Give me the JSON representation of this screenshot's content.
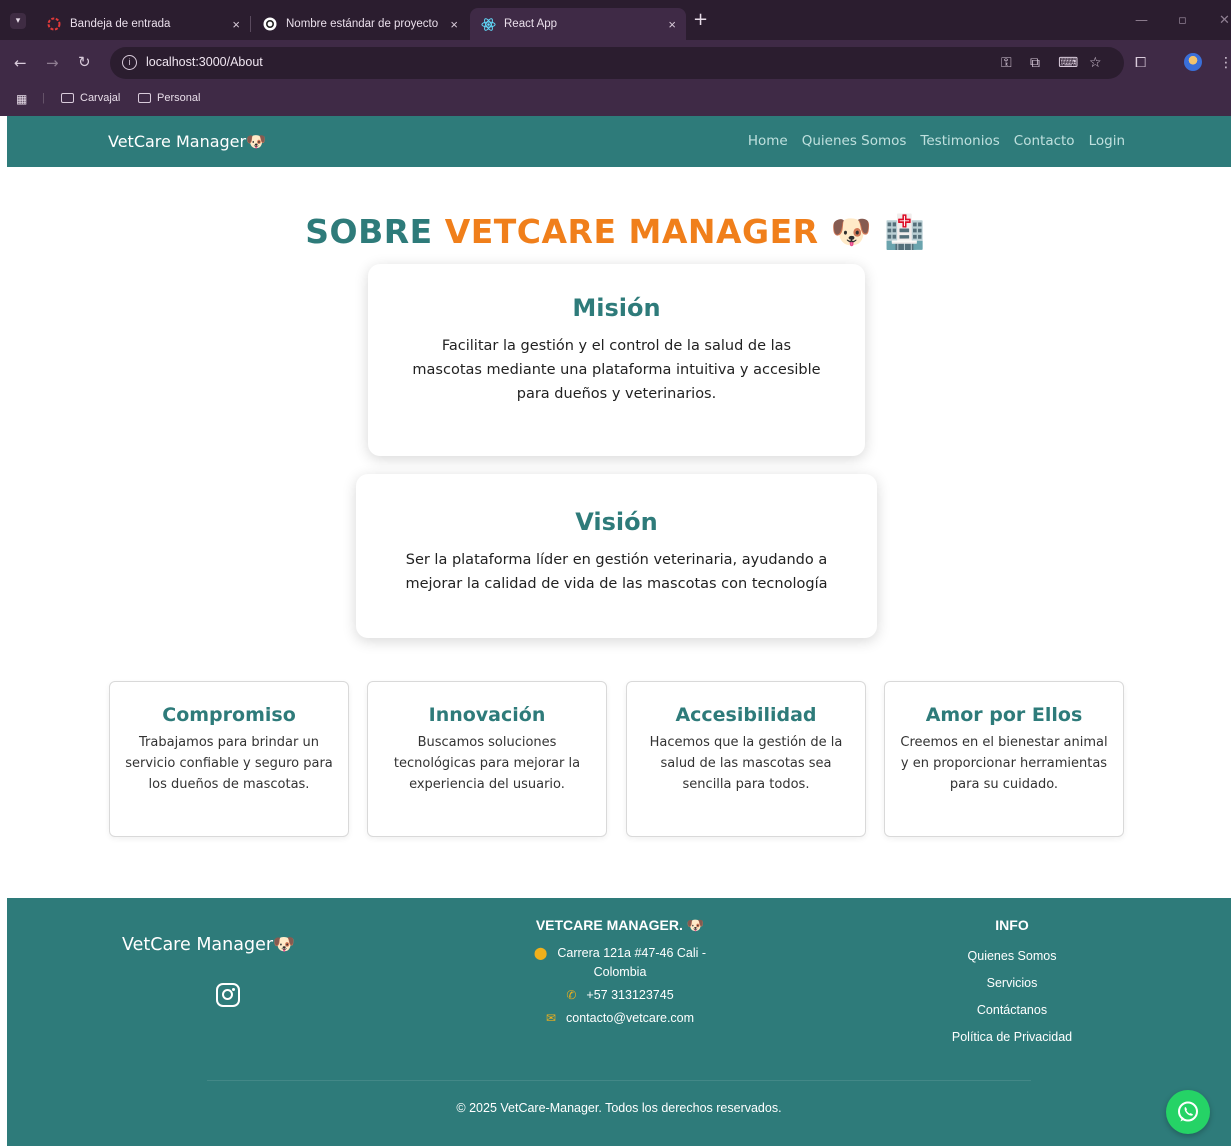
{
  "browser": {
    "tabs": [
      {
        "title": "Bandeja de entrada",
        "close": "×"
      },
      {
        "title": "Nombre estándar de proyecto",
        "close": "×"
      },
      {
        "title": "React App",
        "close": "×"
      }
    ],
    "new_tab": "+",
    "url": "localhost:3000/About",
    "bookmarks": [
      "Carvajal",
      "Personal"
    ]
  },
  "navbar": {
    "brand": "VetCare Manager",
    "brand_emoji": "🐶",
    "links": [
      "Home",
      "Quienes Somos",
      "Testimonios",
      "Contacto",
      "Login"
    ]
  },
  "page": {
    "heading_part1": "SOBRE",
    "heading_part2": "VETCARE MANAGER",
    "heading_emojis": "🐶 🏥",
    "mision": {
      "title": "Misión",
      "text": "Facilitar la gestión y el control de la salud de las mascotas mediante una plataforma intuitiva y accesible para dueños y veterinarios."
    },
    "vision": {
      "title": "Visión",
      "text": "Ser la plataforma líder en gestión veterinaria, ayudando a mejorar la calidad de vida de las mascotas con tecnología"
    },
    "values": [
      {
        "title": "Compromiso",
        "text": "Trabajamos para brindar un servicio confiable y seguro para los dueños de mascotas."
      },
      {
        "title": "Innovación",
        "text": "Buscamos soluciones tecnológicas para mejorar la experiencia del usuario."
      },
      {
        "title": "Accesibilidad",
        "text": "Hacemos que la gestión de la salud de las mascotas sea sencilla para todos."
      },
      {
        "title": "Amor por Ellos",
        "text": "Creemos en el bienestar animal y en proporcionar herramientas para su cuidado."
      }
    ]
  },
  "footer": {
    "brand": "VetCare Manager",
    "brand_emoji": "🐶",
    "contact_title": "VETCARE MANAGER.",
    "address_line1": "Carrera 121a #47-46 Cali -",
    "address_line2": "Colombia",
    "phone": "+57 313123745",
    "email": "contacto@vetcare.com",
    "info_title": "INFO",
    "info_links": [
      "Quienes Somos",
      "Servicios",
      "Contáctanos",
      "Política de Privacidad"
    ],
    "copyright": "© 2025 VetCare-Manager. Todos los derechos reservados."
  },
  "colors": {
    "primary": "#2e7b7a",
    "accent": "#f07f1b",
    "icon_accent": "#f0b01b",
    "whatsapp": "#25d366"
  }
}
